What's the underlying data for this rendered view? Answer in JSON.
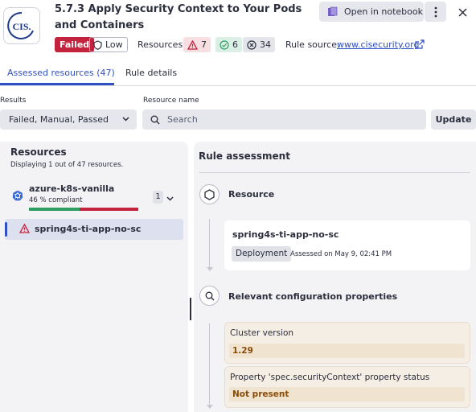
{
  "header": {
    "logo_text": "CIS.",
    "title": "5.7.3 Apply Security Context to Your Pods and Containers",
    "status_badge": "Failed",
    "severity_label": "Low",
    "resources_label": "Resources:",
    "resources_failed": "7",
    "resources_passed": "6",
    "resources_manual": "34",
    "rule_source_label": "Rule source:",
    "rule_source_link": "www.cisecurity.org",
    "open_notebook_label": "Open in notebook",
    "colors": {
      "failed": "#c4233e",
      "passed": "#2f9e63",
      "link": "#2f4fc4"
    }
  },
  "tabs": [
    {
      "label": "Assessed resources (47)",
      "active": true
    },
    {
      "label": "Rule details",
      "active": false
    }
  ],
  "filters": {
    "results_label": "Results",
    "results_value": "Failed, Manual, Passed",
    "resource_name_label": "Resource name",
    "search_placeholder": "Search",
    "update_label": "Update"
  },
  "resources_panel": {
    "title": "Resources",
    "subtitle": "Displaying 1 out of 47 resources.",
    "cluster": {
      "name": "azure-k8s-vanilla",
      "compliance_text": "46 % compliant",
      "compliance_fraction": 0.46,
      "count": "1"
    },
    "selected_resource": "spring4s-ti-app-no-sc"
  },
  "assessment": {
    "title": "Rule assessment",
    "resource_step_title": "Resource",
    "resource_name": "spring4s-ti-app-no-sc",
    "resource_kind": "Deployment",
    "assessed_on": "Assessed on May 9, 02:41 PM",
    "config_step_title": "Relevant configuration properties",
    "properties": [
      {
        "label": "Cluster version",
        "value": "1.29"
      },
      {
        "label": "Property 'spec.securityContext' property status",
        "value": "Not present"
      }
    ]
  }
}
